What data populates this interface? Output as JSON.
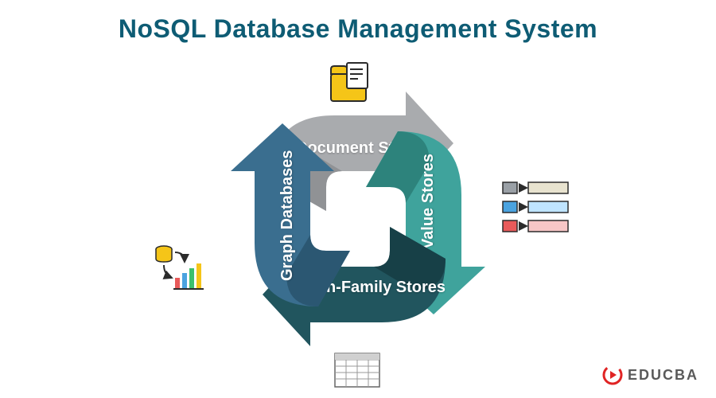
{
  "title": "NoSQL Database Management System",
  "arrows": {
    "top": {
      "label": "Document Stores",
      "color": "#A9ABAE",
      "shade": "#8D8F92"
    },
    "right": {
      "label": "Key-Value Stores",
      "color": "#3FA39C",
      "shade": "#2B7F79"
    },
    "bottom": {
      "label": "Column-Family Stores",
      "color": "#21555E",
      "shade": "#163E45"
    },
    "left": {
      "label": "Graph Databases",
      "color": "#3A6E8F",
      "shade": "#2A546F"
    }
  },
  "logo": {
    "text": "EDUCBA"
  }
}
